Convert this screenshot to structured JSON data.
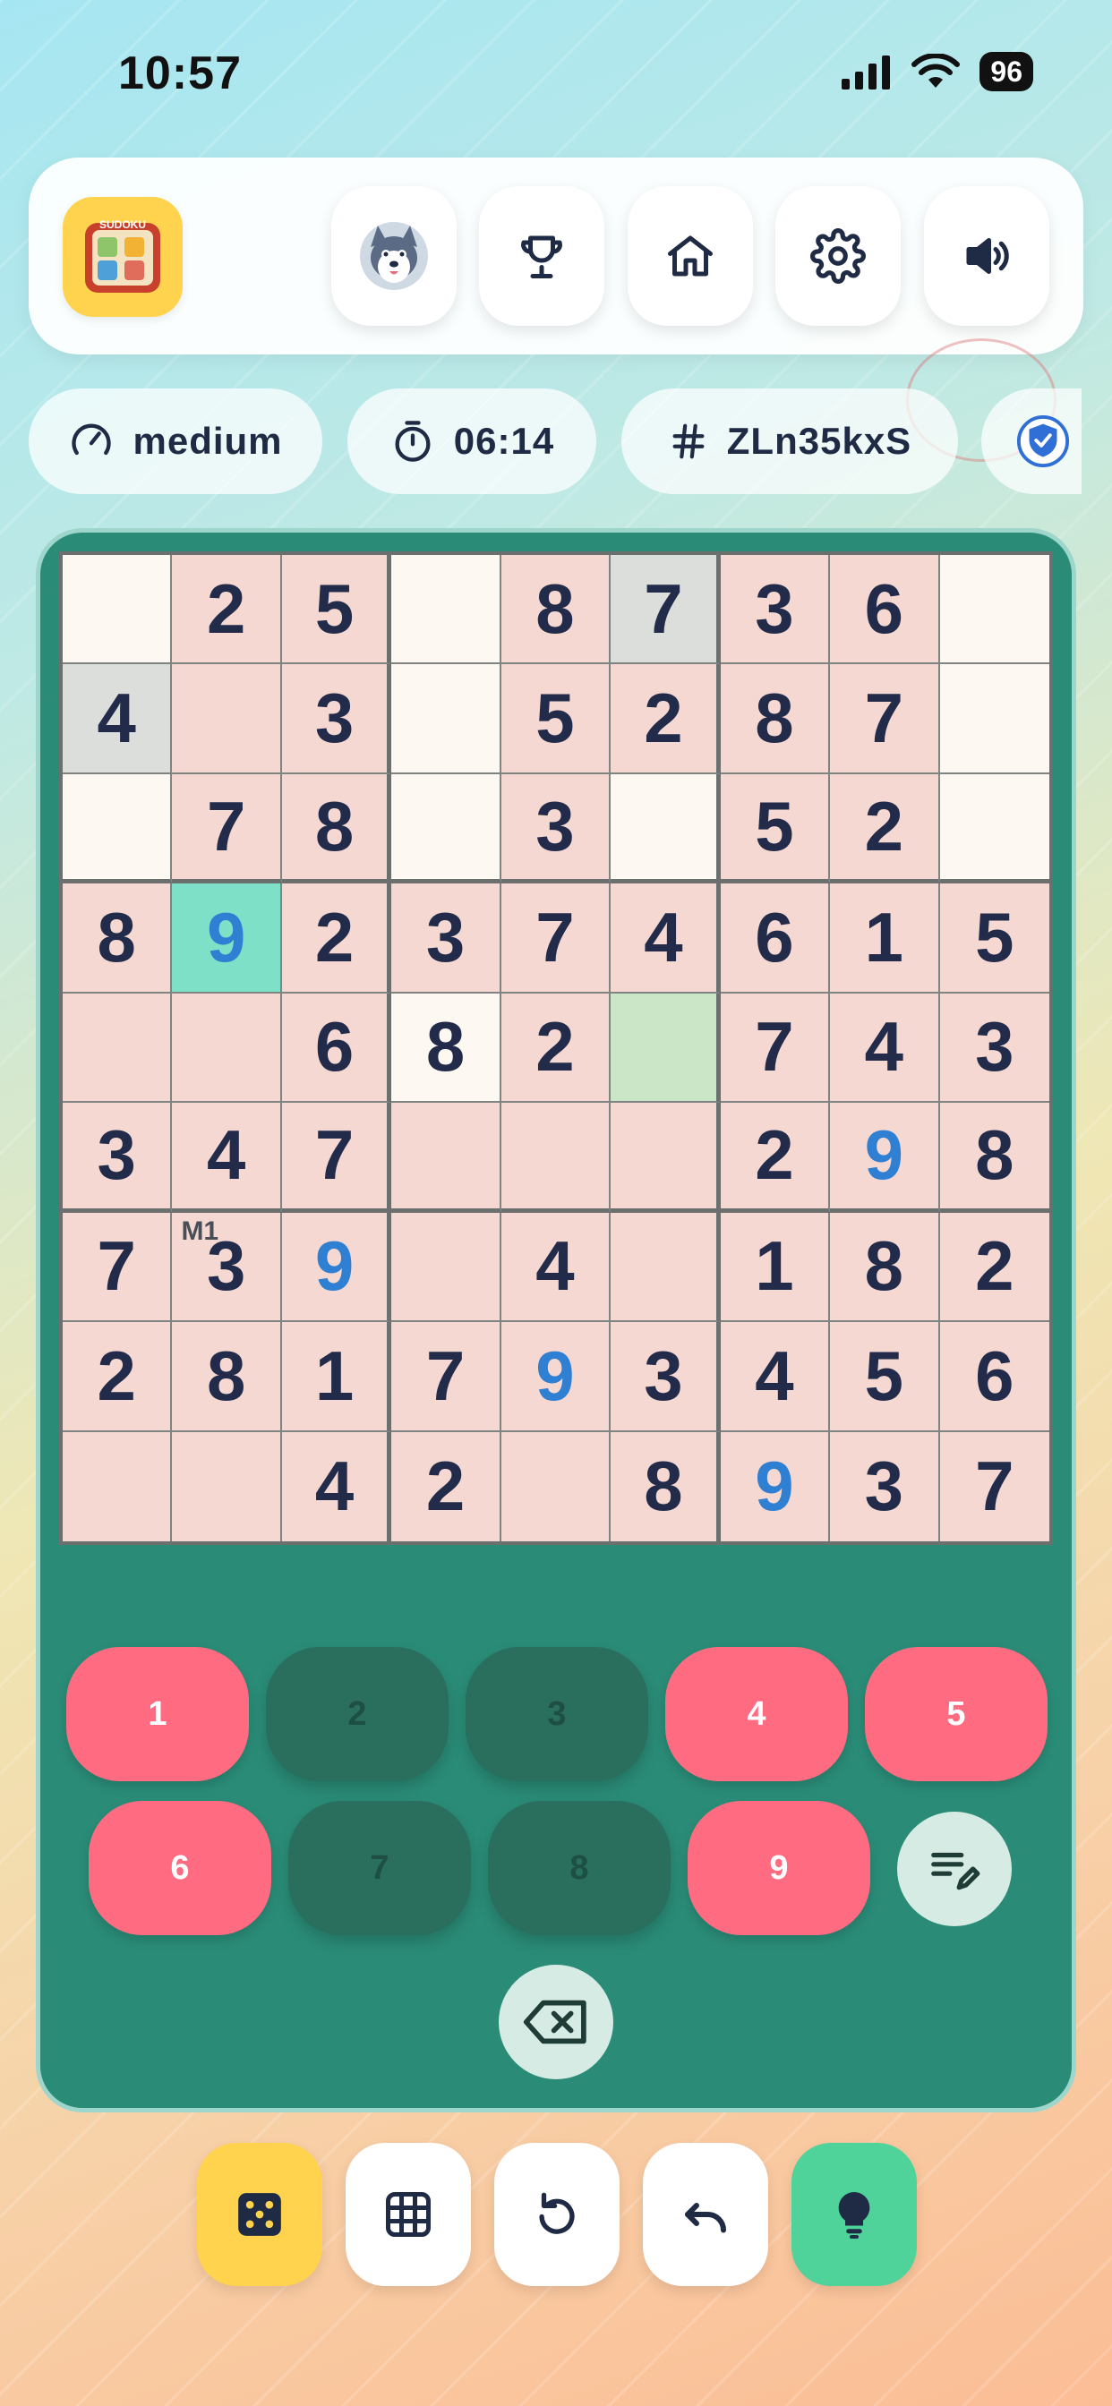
{
  "status_bar": {
    "time": "10:57",
    "battery": "96"
  },
  "header": {
    "logo_text": "SUDOKU",
    "buttons": [
      {
        "name": "avatar-button",
        "icon": "husky-avatar-icon"
      },
      {
        "name": "trophy-button",
        "icon": "trophy-icon"
      },
      {
        "name": "home-button",
        "icon": "home-icon"
      },
      {
        "name": "settings-button",
        "icon": "gear-icon"
      },
      {
        "name": "sound-button",
        "icon": "speaker-icon"
      }
    ]
  },
  "info": {
    "difficulty": "medium",
    "timer": "06:14",
    "puzzle_id": "ZLn35kxS"
  },
  "board": {
    "rows": [
      [
        "",
        "2",
        "5",
        "",
        "8",
        "7",
        "3",
        "6",
        ""
      ],
      [
        "4",
        "",
        "3",
        "",
        "5",
        "2",
        "8",
        "7",
        ""
      ],
      [
        "",
        "7",
        "8",
        "",
        "3",
        "",
        "5",
        "2",
        ""
      ],
      [
        "8",
        "9",
        "2",
        "3",
        "7",
        "4",
        "6",
        "1",
        "5"
      ],
      [
        "",
        "",
        "6",
        "8",
        "2",
        "",
        "7",
        "4",
        "3"
      ],
      [
        "3",
        "4",
        "7",
        "",
        "",
        "",
        "2",
        "9",
        "8"
      ],
      [
        "7",
        "3",
        "9",
        "",
        "4",
        "",
        "1",
        "8",
        "2"
      ],
      [
        "2",
        "8",
        "1",
        "7",
        "9",
        "3",
        "4",
        "5",
        "6"
      ],
      [
        "",
        "",
        "4",
        "2",
        "",
        "8",
        "9",
        "3",
        "7"
      ]
    ],
    "user_entries": [
      [
        3,
        1
      ],
      [
        5,
        7
      ],
      [
        6,
        2
      ],
      [
        7,
        4
      ],
      [
        8,
        6
      ]
    ],
    "note": {
      "row": 6,
      "col": 1,
      "text": "M1"
    },
    "colors": {
      "cream": "#fdf8f1",
      "pink": "#f5d8d2",
      "gray": "#dbdedb",
      "mint": "#7ee0c6",
      "green": "#cbe6c6",
      "given": "#222c4a",
      "user": "#2f7fd2"
    }
  },
  "keypad": {
    "keys": [
      {
        "label": "1",
        "enabled": true
      },
      {
        "label": "2",
        "enabled": false
      },
      {
        "label": "3",
        "enabled": false
      },
      {
        "label": "4",
        "enabled": true
      },
      {
        "label": "5",
        "enabled": true
      },
      {
        "label": "6",
        "enabled": true
      },
      {
        "label": "7",
        "enabled": false
      },
      {
        "label": "8",
        "enabled": false
      },
      {
        "label": "9",
        "enabled": true
      }
    ],
    "notes_icon": "pencil-notes-icon",
    "erase_icon": "backspace-icon"
  },
  "toolbar": {
    "items": [
      {
        "name": "dice-button",
        "icon": "dice-icon",
        "color": "#ffd34d"
      },
      {
        "name": "grid-button",
        "icon": "grid-icon",
        "color": "#ffffff"
      },
      {
        "name": "restart-button",
        "icon": "restart-icon",
        "color": "#ffffff"
      },
      {
        "name": "undo-button",
        "icon": "undo-icon",
        "color": "#ffffff"
      },
      {
        "name": "hint-button",
        "icon": "lightbulb-icon",
        "color": "#4fd39a"
      }
    ]
  }
}
